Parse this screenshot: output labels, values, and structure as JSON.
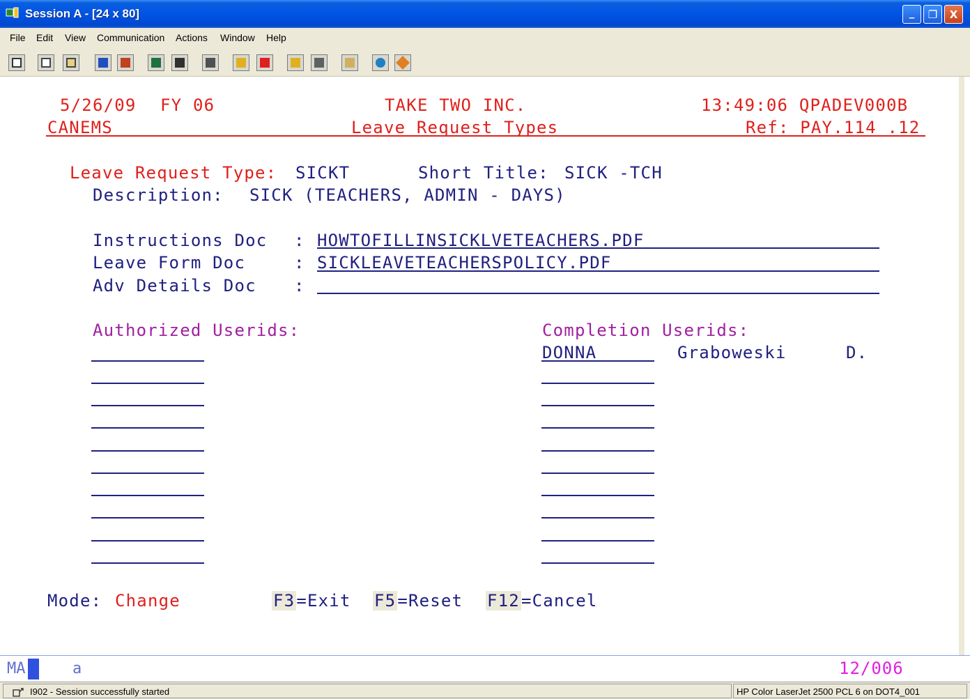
{
  "window": {
    "title": "Session A - [24 x 80]",
    "buttons": [
      "_",
      "❐",
      "X"
    ]
  },
  "menu": [
    "File",
    "Edit",
    "View",
    "Communication",
    "Actions",
    "Window",
    "Help"
  ],
  "toolbar_icons": [
    "print-screen-icon",
    "copy-icon",
    "paste-icon",
    "send-icon",
    "receive-icon",
    "display-icon",
    "keypad-icon",
    "macro-record-icon",
    "macro-play-icon",
    "macro-stop-icon",
    "macro-edit-icon",
    "macro-run-icon",
    "clipboard-icon",
    "globe-icon",
    "map-icon"
  ],
  "header": {
    "date": "5/26/09",
    "fy": "FY 06",
    "company": "TAKE TWO INC.",
    "time_system": "13:49:06 QPADEV000B",
    "app": "CANEMS",
    "screen_title": "Leave Request Types",
    "ref": "Ref: PAY.114 .12"
  },
  "form": {
    "leave_type_label": "Leave Request Type:",
    "leave_type_value": "SICKT",
    "short_title_label": "Short Title:",
    "short_title_value": "SICK -TCH",
    "description_label": "Description:",
    "description_value": "SICK (TEACHERS, ADMIN - DAYS)",
    "instructions_label": "Instructions Doc",
    "instructions_value": "HOWTOFILLINSICKLVETEACHERS.PDF",
    "leave_form_label": "Leave Form Doc",
    "leave_form_value": "SICKLEAVETEACHERSPOLICY.PDF",
    "adv_details_label": "Adv Details Doc",
    "adv_details_value": "",
    "colon": ":"
  },
  "authorized": {
    "label": "Authorized Userids:",
    "rows": [
      "",
      "",
      "",
      "",
      "",
      "",
      "",
      "",
      "",
      ""
    ]
  },
  "completion": {
    "label": "Completion Userids:",
    "rows": [
      {
        "userid": "DONNA",
        "last": "Graboweski",
        "initial": "D."
      },
      {
        "userid": "",
        "last": "",
        "initial": ""
      },
      {
        "userid": "",
        "last": "",
        "initial": ""
      },
      {
        "userid": "",
        "last": "",
        "initial": ""
      },
      {
        "userid": "",
        "last": "",
        "initial": ""
      },
      {
        "userid": "",
        "last": "",
        "initial": ""
      },
      {
        "userid": "",
        "last": "",
        "initial": ""
      },
      {
        "userid": "",
        "last": "",
        "initial": ""
      },
      {
        "userid": "",
        "last": "",
        "initial": ""
      },
      {
        "userid": "",
        "last": "",
        "initial": ""
      }
    ]
  },
  "footer": {
    "mode_label": "Mode:",
    "mode_value": "Change",
    "f3_key": "F3",
    "f3_text": "=Exit",
    "f5_key": "F5",
    "f5_text": "=Reset",
    "f12_key": "F12",
    "f12_text": "=Cancel"
  },
  "oia": {
    "ma": "MA",
    "a": "a",
    "cursor_pos": "12/006"
  },
  "status": {
    "message": "I902 - Session successfully started",
    "printer": "HP Color LaserJet 2500 PCL 6 on DOT4_001"
  },
  "colors": {
    "red": "#e0201c",
    "blue": "#202080",
    "purple": "#a020a0",
    "title_bar": "#0054e3"
  }
}
